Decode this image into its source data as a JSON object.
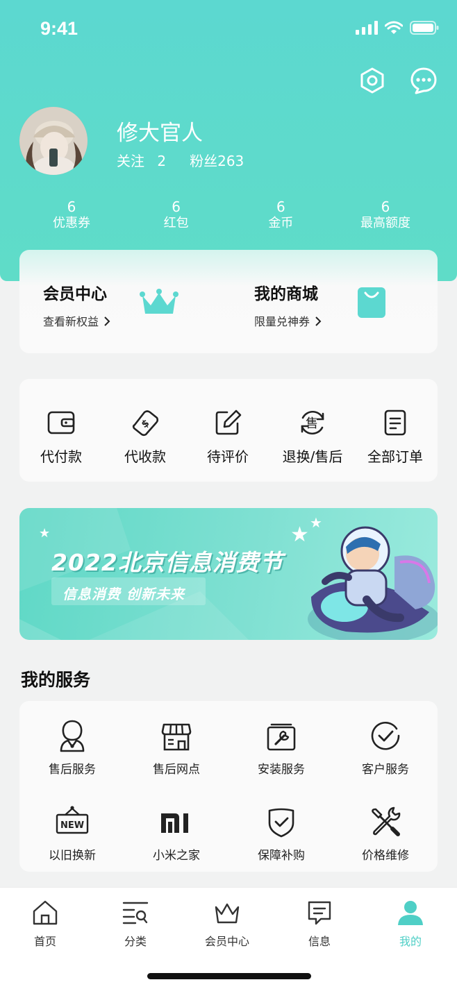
{
  "status_bar": {
    "time": "9:41"
  },
  "profile": {
    "name": "修大官人",
    "follow_label": "关注",
    "follow_count": "2",
    "fans_label": "粉丝263"
  },
  "stats": [
    {
      "value": "6",
      "label": "优惠券"
    },
    {
      "value": "6",
      "label": "红包"
    },
    {
      "value": "6",
      "label": "金币"
    },
    {
      "value": "6",
      "label": "最高额度"
    }
  ],
  "member_card": {
    "member_center_title": "会员中心",
    "member_center_sub": "查看新权益",
    "mall_title": "我的商城",
    "mall_sub": "限量兑神券"
  },
  "orders": [
    {
      "label": "代付款",
      "icon": "wallet-icon"
    },
    {
      "label": "代收款",
      "icon": "money-icon"
    },
    {
      "label": "待评价",
      "icon": "edit-icon"
    },
    {
      "label": "退换/售后",
      "icon": "after-sale-icon"
    },
    {
      "label": "全部订单",
      "icon": "order-list-icon"
    }
  ],
  "banner": {
    "title": "2022北京信息消费节",
    "subtitle": "信息消费 创新未来"
  },
  "services": {
    "title": "我的服务",
    "items": [
      {
        "label": "售后服务",
        "icon": "customer-service-person-icon"
      },
      {
        "label": "售后网点",
        "icon": "store-icon"
      },
      {
        "label": "安装服务",
        "icon": "wrench-icon"
      },
      {
        "label": "客户服务",
        "icon": "check-circle-icon"
      },
      {
        "label": "以旧换新",
        "icon": "new-sign-icon",
        "badge": "NEW"
      },
      {
        "label": "小米之家",
        "icon": "mi-logo-icon",
        "badge": "mi"
      },
      {
        "label": "保障补购",
        "icon": "shield-check-icon"
      },
      {
        "label": "价格维修",
        "icon": "tools-icon"
      }
    ]
  },
  "tabbar": [
    {
      "label": "首页",
      "icon": "home-icon"
    },
    {
      "label": "分类",
      "icon": "category-icon"
    },
    {
      "label": "会员中心",
      "icon": "crown-icon"
    },
    {
      "label": "信息",
      "icon": "message-icon"
    },
    {
      "label": "我的",
      "icon": "profile-icon",
      "active": true
    }
  ],
  "colors": {
    "accent": "#5cd8d0",
    "active_tab": "#4fcfc6"
  }
}
